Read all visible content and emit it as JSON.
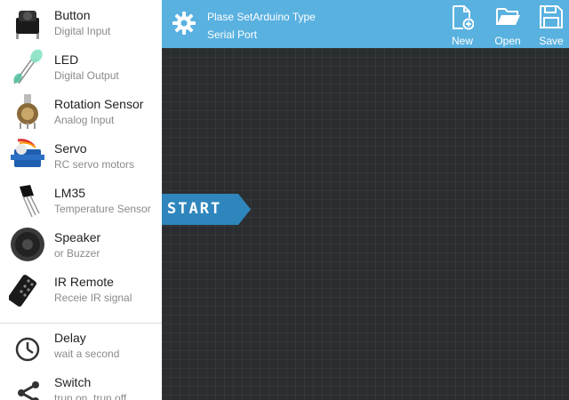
{
  "sidebar": {
    "items": [
      {
        "title": "Button",
        "subtitle": "Digital Input",
        "icon": "push-button-icon"
      },
      {
        "title": "LED",
        "subtitle": "Digital Output",
        "icon": "led-icon"
      },
      {
        "title": "Rotation Sensor",
        "subtitle": "Analog Input",
        "icon": "potentiometer-icon"
      },
      {
        "title": "Servo",
        "subtitle": "RC servo motors",
        "icon": "servo-icon"
      },
      {
        "title": "LM35",
        "subtitle": "Temperature Sensor",
        "icon": "lm35-icon"
      },
      {
        "title": "Speaker",
        "subtitle": "or Buzzer",
        "icon": "speaker-icon"
      },
      {
        "title": "IR Remote",
        "subtitle": "Receie IR signal",
        "icon": "ir-remote-icon"
      }
    ],
    "control_items": [
      {
        "title": "Delay",
        "subtitle": "wait a second",
        "icon": "clock-icon"
      },
      {
        "title": "Switch",
        "subtitle": "trun on, trun off",
        "icon": "share-icon"
      }
    ]
  },
  "topbar": {
    "status_line1": "Plase SetArduino Type",
    "status_line2": "Serial Port",
    "settings_icon": "gear-icon",
    "buttons": [
      {
        "label": "New",
        "icon": "new-file-icon"
      },
      {
        "label": "Open",
        "icon": "folder-open-icon"
      },
      {
        "label": "Save",
        "icon": "floppy-disk-icon"
      }
    ]
  },
  "canvas": {
    "start_block_label": "START"
  },
  "colors": {
    "topbar": "#59b1e0",
    "canvas": "#2b2e30",
    "start_block": "#2f86bd"
  }
}
